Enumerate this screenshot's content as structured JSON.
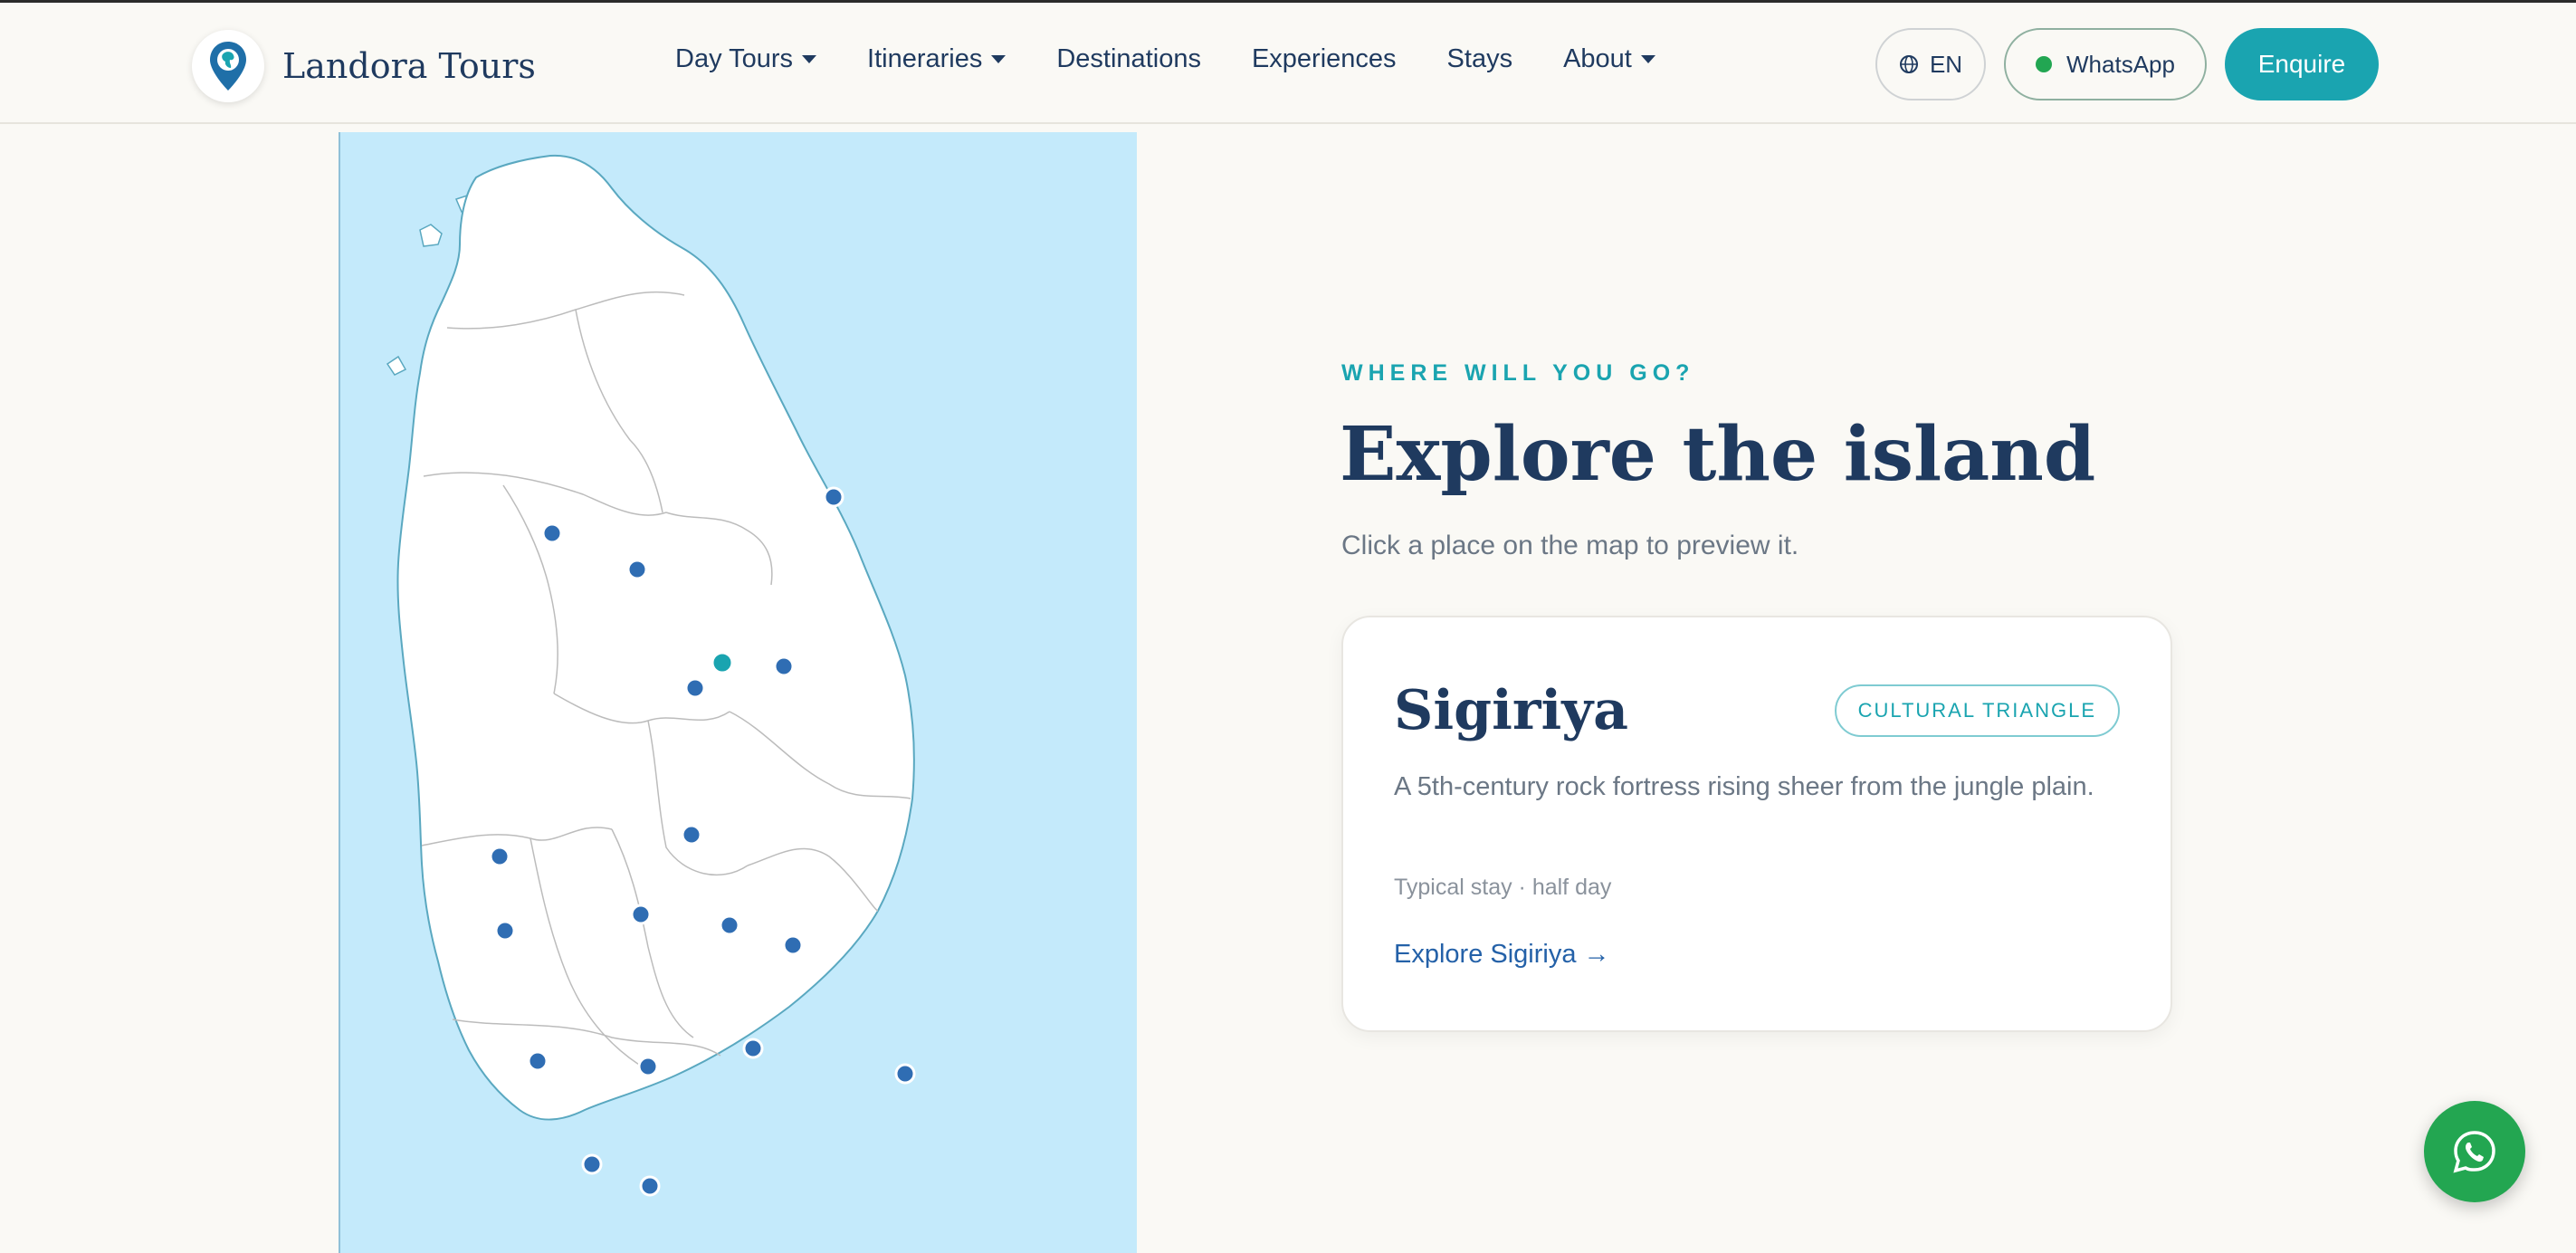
{
  "header": {
    "brand": "Landora Tours",
    "nav": [
      {
        "label": "Day Tours",
        "dropdown": true
      },
      {
        "label": "Itineraries",
        "dropdown": true
      },
      {
        "label": "Destinations",
        "dropdown": false
      },
      {
        "label": "Experiences",
        "dropdown": false
      },
      {
        "label": "Stays",
        "dropdown": false
      },
      {
        "label": "About",
        "dropdown": true
      }
    ],
    "lang_label": "EN",
    "whatsapp_label": "WhatsApp",
    "enquire_label": "Enquire"
  },
  "hero": {
    "eyebrow": "WHERE WILL YOU GO?",
    "title": "Explore the island",
    "subtitle": "Click a place on the map to preview it."
  },
  "card": {
    "title": "Sigiriya",
    "badge": "CULTURAL TRIANGLE",
    "description": "A 5th-century rock fortress rising sheer from the jungle plain.",
    "meta": "Typical stay · half day",
    "link": "Explore Sigiriya →"
  },
  "map": {
    "selected_index": 2,
    "colors": {
      "sea": "#c4eafb",
      "land": "#ffffff",
      "coast": "#5aa8c0",
      "marker": "#2f6db3",
      "selected": "#1aa4b0"
    }
  },
  "colors": {
    "accent": "#1aa4b0",
    "navy": "#1f3a5f",
    "whatsapp": "#23a651"
  },
  "icons": {
    "logo": "map-pin-logo-icon",
    "language": "globe-icon",
    "fab": "whatsapp-icon"
  }
}
